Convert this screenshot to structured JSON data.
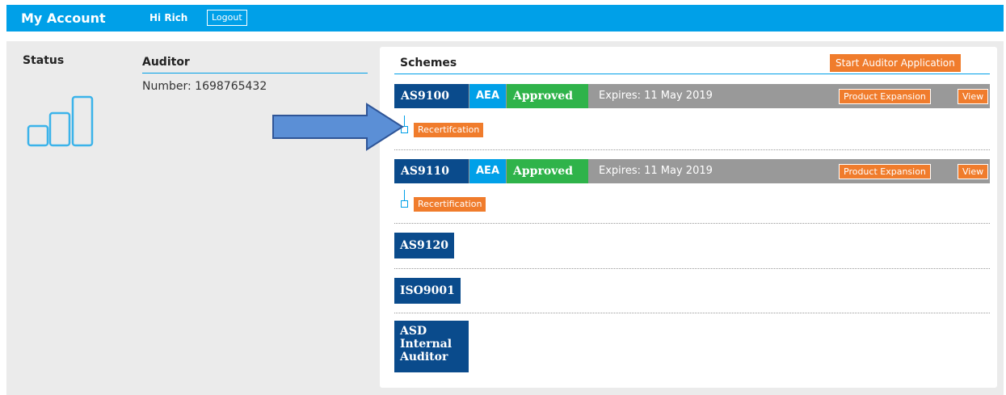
{
  "topbar": {
    "brand": "My Account",
    "greeting": "Hi Rich",
    "logout": "Logout",
    "color": "#00a0e8"
  },
  "status": {
    "title": "Status",
    "icon": "bar-chart-icon"
  },
  "auditor": {
    "title": "Auditor",
    "number": "Number: 1698765432"
  },
  "schemes": {
    "title": "Schemes",
    "start_button": "Start Auditor Application",
    "rows": [
      {
        "code": "AS9100",
        "type": "AEA",
        "status": "Approved",
        "expires": "Expires: 11 May 2019",
        "product_expansion": "Product Expansion",
        "view": "View",
        "sub_action": "Recertifcation"
      },
      {
        "code": "AS9110",
        "type": "AEA",
        "status": "Approved",
        "expires": "Expires: 11 May 2019",
        "product_expansion": "Product Expansion",
        "view": "View",
        "sub_action": "Recertification"
      }
    ],
    "others": [
      "AS9120",
      "ISO9001"
    ],
    "internal": [
      "ASD",
      "Internal",
      "Auditor"
    ]
  },
  "colors": {
    "navy": "#0a4b8c",
    "blue": "#00a0e8",
    "green": "#2fb34a",
    "orange": "#f07c2c",
    "grey": "#999999",
    "panel": "#ebebeb"
  },
  "annotation": {
    "icon": "right-arrow-icon"
  }
}
